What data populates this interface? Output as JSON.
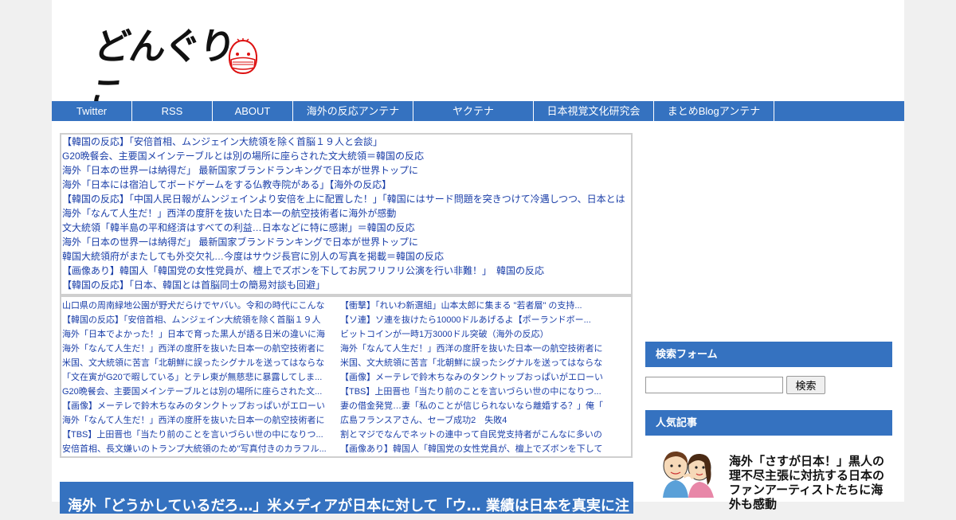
{
  "header": {
    "logo_text": "どんぐりこ",
    "logo_icon": "masked-face-mascot-icon"
  },
  "nav": {
    "items": [
      {
        "label": "Twitter",
        "width": 101
      },
      {
        "label": "RSS",
        "width": 101
      },
      {
        "label": "ABOUT",
        "width": 101
      },
      {
        "label": "海外の反応アンテナ",
        "width": 151
      },
      {
        "label": "ヤクテナ",
        "width": 151
      },
      {
        "label": "日本視覚文化研究会",
        "width": 151
      },
      {
        "label": "まとめBlogアンテナ",
        "width": 151
      }
    ]
  },
  "antenna1": {
    "links": [
      "【韓国の反応】「安倍首相、ムンジェイン大統領を除く首脳１９人と会談」",
      "G20晩餐会、主要国メインテーブルとは別の場所に座らされた文大統領＝韓国の反応",
      "海外「日本の世界一は納得だ」 最新国家ブランドランキングで日本が世界トップに",
      "海外「日本には宿泊してボードゲームをする仏教寺院がある」【海外の反応】",
      "【韓国の反応】「中国人民日報がムンジェインより安倍を上に配置した！」「韓国にはサード問題を突きつけて冷遇しつつ、日本とは",
      "海外「なんて人生だ！」西洋の度肝を抜いた日本一の航空技術者に海外が感動",
      "文大統領「韓半島の平和経済はすべての利益…日本などに特に感謝」＝韓国の反応",
      "海外「日本の世界一は納得だ」 最新国家ブランドランキングで日本が世界トップに",
      "韓国大統領府がまたしても外交欠礼…今度はサウジ長官に別人の写真を掲載＝韓国の反応",
      "【画像あり】韓国人「韓国党の女性党員が、檀上でズボンを下してお尻フリフリ公演を行い非難！」　韓国の反応",
      "【韓国の反応】「日本、韓国とは首脳同士の簡易対談も回避」"
    ]
  },
  "antenna2": {
    "left": [
      "山口県の周南緑地公園が野犬だらけでヤバい。令和の時代にこんな",
      "【韓国の反応】「安倍首相、ムンジェイン大統領を除く首脳１９人",
      "海外「日本でよかった！」日本で育った黒人が語る日米の違いに海",
      "海外「なんて人生だ！」西洋の度肝を抜いた日本一の航空技術者に",
      "米国、文大統領に苦言「北朝鮮に誤ったシグナルを送ってはならな",
      "「文在寅がG20で暇している」とテレ東が無慈悲に暴露してしま...",
      "G20晩餐会、主要国メインテーブルとは別の場所に座らされた文...",
      "【画像】メーテレで鈴木ちなみのタンクトップおっぱいがエローい",
      "海外「なんて人生だ！」西洋の度肝を抜いた日本一の航空技術者に",
      "【TBS】上田晋也「当たり前のことを言いづらい世の中になりつ...",
      "安倍首相、長文嫌いのトランプ大統領のため\"写真付きのカラフル..."
    ],
    "right": [
      "【衝撃】「れいわ新選組」山本太郎に集まる \"若者層\" の支持...",
      "【ソ連】ソ連を抜けたら10000ドルあげるよ【ポーランドボー...",
      "ビットコインが一時1万3000ドル突破（海外の反応）",
      "海外「なんて人生だ！」西洋の度肝を抜いた日本一の航空技術者に",
      "米国、文大統領に苦言「北朝鮮に誤ったシグナルを送ってはならな",
      "【画像】メーテレで鈴木ちなみのタンクトップおっぱいがエローい",
      "【TBS】上田晋也「当たり前のことを言いづらい世の中になりつ...",
      "妻の借金発覚…妻「私のことが信じられないなら離婚する？」俺「",
      "広島フランスアさん、セーブ成功2　失敗4",
      "割とマジでなんでネットの連中って自民党支持者がこんなに多いの",
      "【画像あり】韓国人「韓国党の女性党員が、檀上でズボンを下して"
    ]
  },
  "article": {
    "title": "海外「どうかしているだろ…」米メディアが日本に対して「ウ… 業績は日本を真実に注"
  },
  "sidebar": {
    "search_heading": "検索フォーム",
    "search_placeholder": "",
    "search_button": "検索",
    "popular_heading": "人気記事",
    "popular_item_text": "海外「さすが日本！」黒人の理不尽主張に対抗する日本のファンアーティストたちに海外も感動",
    "popular_item_icon": "girls-illustration-thumbnail"
  }
}
